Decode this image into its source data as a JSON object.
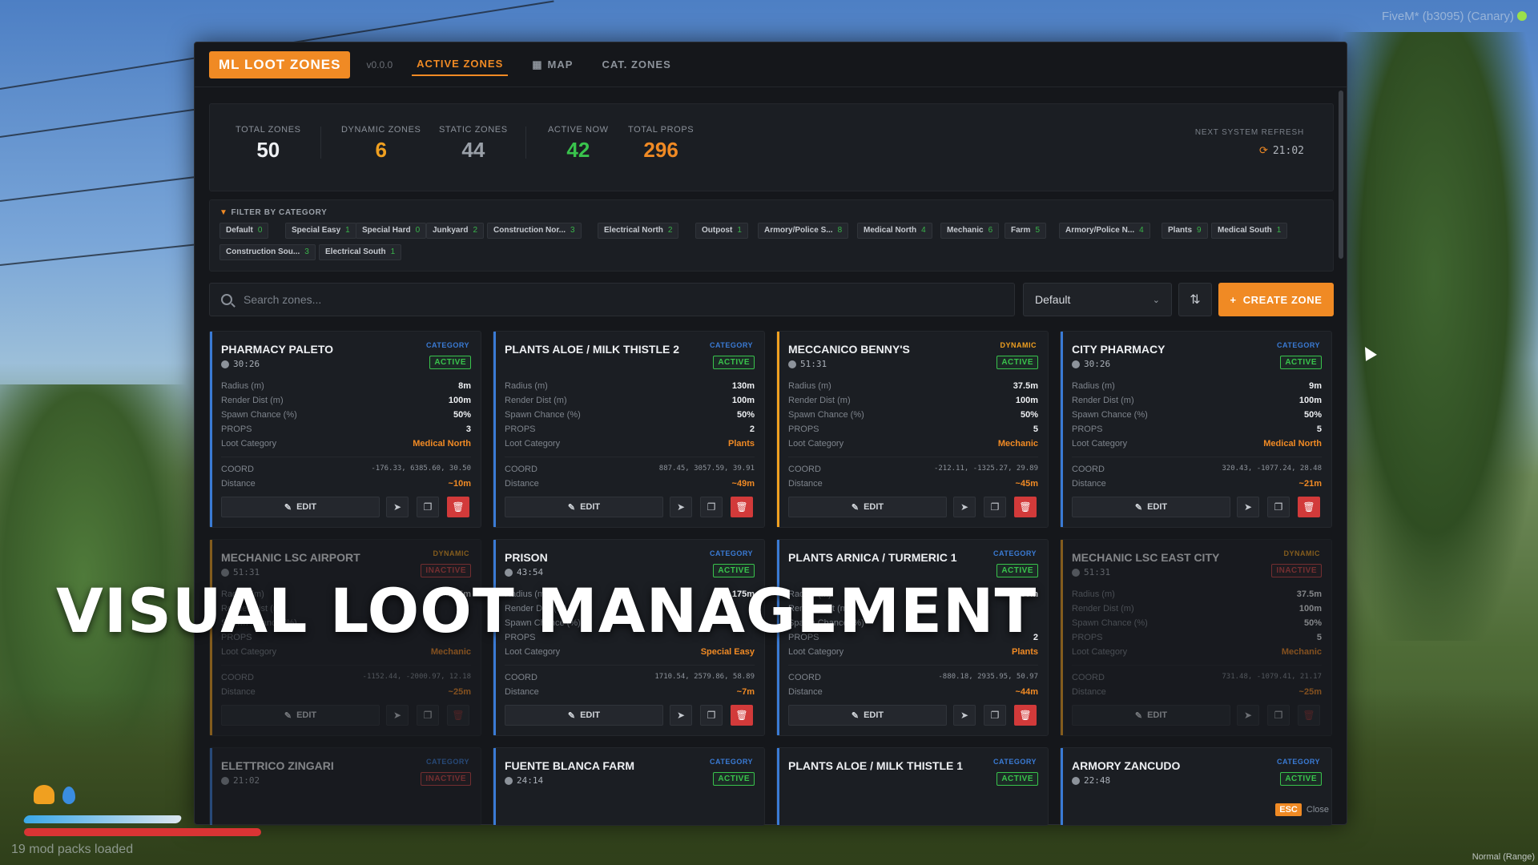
{
  "overlay": {
    "fivem": "FiveM* (b3095) (Canary)",
    "headline": "VISUAL LOOT MANAGEMENT",
    "mods": "19 mod packs loaded",
    "mode": "Normal (Range)"
  },
  "header": {
    "brand": "ML LOOT ZONES",
    "version": "v0.0.0",
    "tabs": [
      {
        "label": "ACTIVE ZONES"
      },
      {
        "label": "MAP"
      },
      {
        "label": "CAT. ZONES"
      }
    ]
  },
  "stats": {
    "total_zones": {
      "label": "TOTAL ZONES",
      "value": "50"
    },
    "dynamic_zones": {
      "label": "DYNAMIC ZONES",
      "value": "6"
    },
    "static_zones": {
      "label": "STATIC ZONES",
      "value": "44"
    },
    "active_now": {
      "label": "ACTIVE NOW",
      "value": "42"
    },
    "total_props": {
      "label": "TOTAL PROPS",
      "value": "296"
    },
    "refresh": {
      "label": "NEXT SYSTEM REFRESH",
      "value": "21:02"
    }
  },
  "filter": {
    "title": "FILTER BY CATEGORY",
    "chips": [
      {
        "label": "Default",
        "count": "0"
      },
      {
        "label": "Special Easy",
        "count": "1"
      },
      {
        "label": "Special Hard",
        "count": "0"
      },
      {
        "label": "Junkyard",
        "count": "2"
      },
      {
        "label": "Construction Nor...",
        "count": "3"
      },
      {
        "label": "Electrical North",
        "count": "2"
      },
      {
        "label": "Outpost",
        "count": "1"
      },
      {
        "label": "Armory/Police S...",
        "count": "8"
      },
      {
        "label": "Medical North",
        "count": "4"
      },
      {
        "label": "Mechanic",
        "count": "6"
      },
      {
        "label": "Farm",
        "count": "5"
      },
      {
        "label": "Armory/Police N...",
        "count": "4"
      },
      {
        "label": "Plants",
        "count": "9"
      },
      {
        "label": "Medical South",
        "count": "1"
      },
      {
        "label": "Construction Sou...",
        "count": "3"
      },
      {
        "label": "Electrical South",
        "count": "1"
      }
    ]
  },
  "toolbar": {
    "search_placeholder": "Search zones...",
    "select_value": "Default",
    "create_label": "CREATE ZONE"
  },
  "labels": {
    "radius": "Radius (m)",
    "render": "Render Dist (m)",
    "spawn": "Spawn Chance (%)",
    "props": "PROPS",
    "loot": "Loot Category",
    "coord": "COORD",
    "distance": "Distance",
    "edit": "EDIT",
    "esc": "ESC",
    "close": "Close"
  },
  "colors": {
    "accent": "#f08a24",
    "category": "#3a7bd5",
    "dynamic": "#f0a020",
    "active": "#39c34c",
    "inactive": "#d04545"
  },
  "zones": [
    {
      "name": "PHARMACY PALETO",
      "type": "CATEGORY",
      "status": "ACTIVE",
      "time": "30:26",
      "radius": "8m",
      "render": "100m",
      "spawn": "50%",
      "props": "3",
      "loot": "Medical North",
      "coord": "-176.33, 6385.60, 30.50",
      "distance": "~10m"
    },
    {
      "name": "PLANTS ALOE / MILK THISTLE 2",
      "type": "CATEGORY",
      "status": "ACTIVE",
      "time": "",
      "radius": "130m",
      "render": "100m",
      "spawn": "50%",
      "props": "2",
      "loot": "Plants",
      "coord": "887.45, 3057.59, 39.91",
      "distance": "~49m"
    },
    {
      "name": "MECCANICO BENNY'S",
      "type": "DYNAMIC",
      "status": "ACTIVE",
      "time": "51:31",
      "radius": "37.5m",
      "render": "100m",
      "spawn": "50%",
      "props": "5",
      "loot": "Mechanic",
      "coord": "-212.11, -1325.27, 29.89",
      "distance": "~45m"
    },
    {
      "name": "CITY PHARMACY",
      "type": "CATEGORY",
      "status": "ACTIVE",
      "time": "30:26",
      "radius": "9m",
      "render": "100m",
      "spawn": "50%",
      "props": "5",
      "loot": "Medical North",
      "coord": "320.43, -1077.24, 28.48",
      "distance": "~21m"
    },
    {
      "name": "MECHANIC LSC AIRPORT",
      "type": "DYNAMIC",
      "status": "INACTIVE",
      "time": "51:31",
      "radius": "41.5m",
      "render": "",
      "spawn": "",
      "props": "",
      "loot": "Mechanic",
      "coord": "-1152.44, -2000.97, 12.18",
      "distance": "~25m"
    },
    {
      "name": "PRISON",
      "type": "CATEGORY",
      "status": "ACTIVE",
      "time": "43:54",
      "radius": "175m",
      "render": "",
      "spawn": "",
      "props": "",
      "loot": "Special Easy",
      "coord": "1710.54, 2579.86, 58.89",
      "distance": "~7m"
    },
    {
      "name": "PLANTS ARNICA / TURMERIC 1",
      "type": "CATEGORY",
      "status": "ACTIVE",
      "time": "",
      "radius": "130m",
      "render": "",
      "spawn": "",
      "props": "2",
      "loot": "Plants",
      "coord": "-880.18, 2935.95, 50.97",
      "distance": "~44m"
    },
    {
      "name": "MECHANIC LSC EAST CITY",
      "type": "DYNAMIC",
      "status": "INACTIVE",
      "time": "51:31",
      "radius": "37.5m",
      "render": "100m",
      "spawn": "50%",
      "props": "5",
      "loot": "Mechanic",
      "coord": "731.48, -1079.41, 21.17",
      "distance": "~25m"
    },
    {
      "name": "ELETTRICO ZINGARI",
      "type": "CATEGORY",
      "status": "INACTIVE",
      "time": "21:02"
    },
    {
      "name": "FUENTE BLANCA FARM",
      "type": "CATEGORY",
      "status": "ACTIVE",
      "time": "24:14"
    },
    {
      "name": "PLANTS ALOE / MILK THISTLE 1",
      "type": "CATEGORY",
      "status": "ACTIVE",
      "time": ""
    },
    {
      "name": "ARMORY ZANCUDO",
      "type": "CATEGORY",
      "status": "ACTIVE",
      "time": "22:48"
    }
  ]
}
